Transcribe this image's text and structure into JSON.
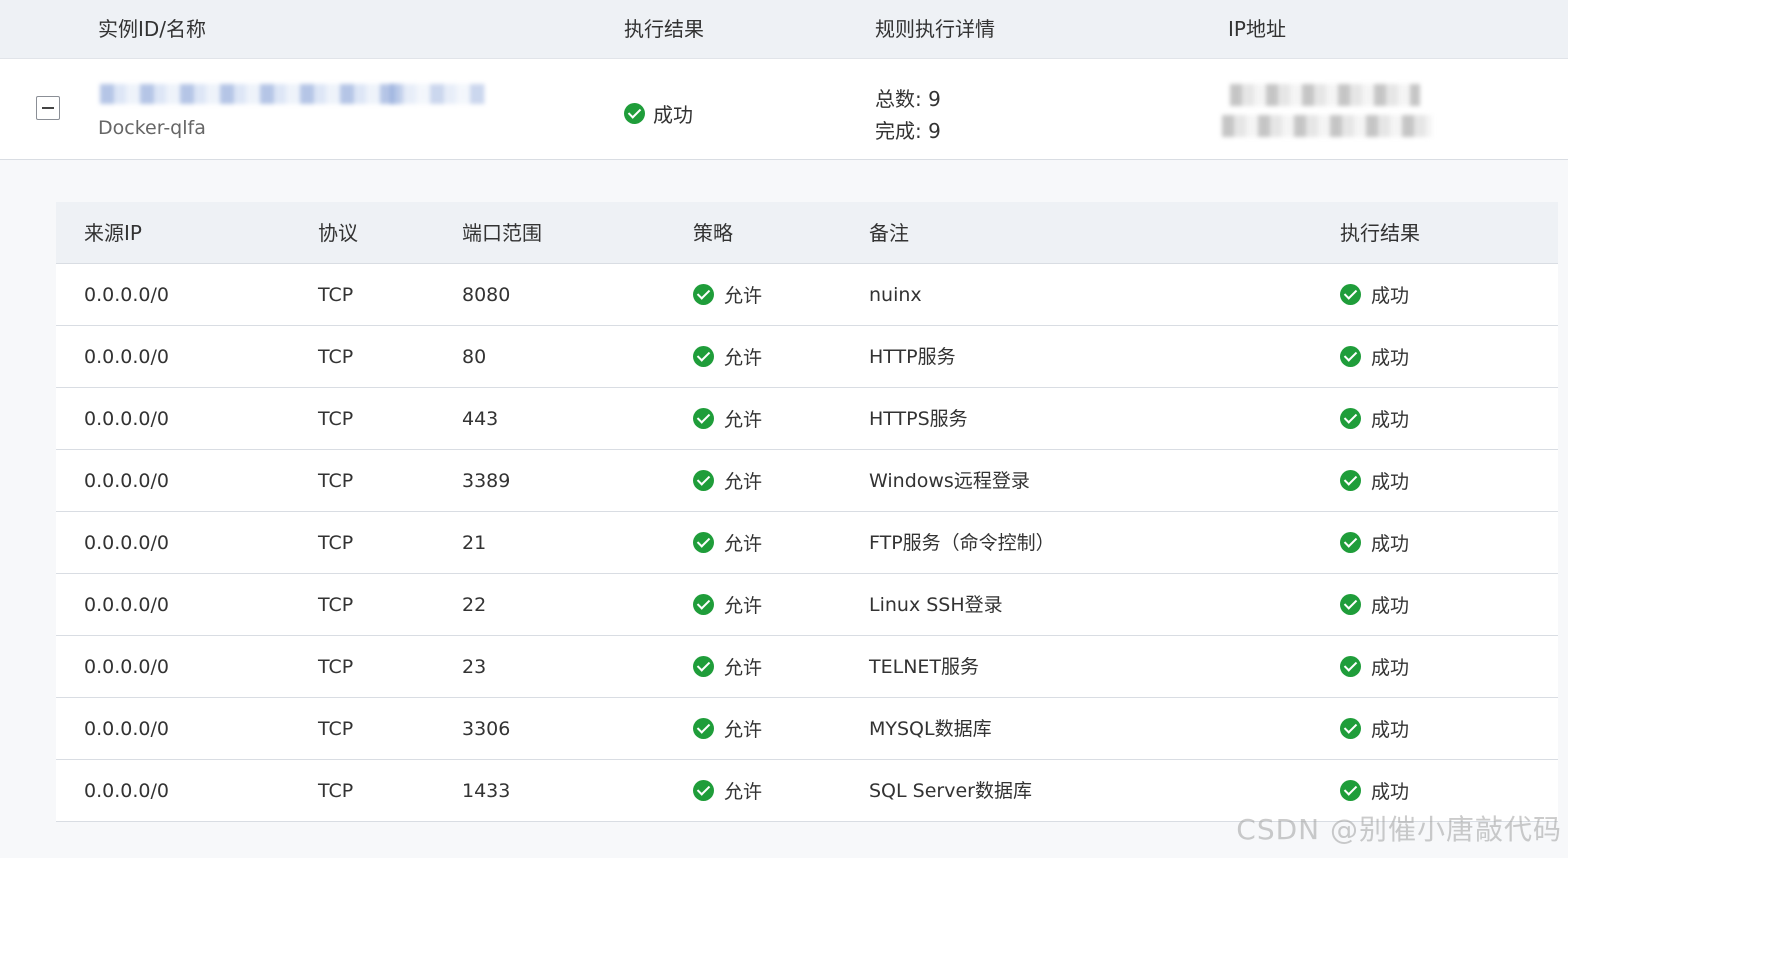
{
  "outer_table": {
    "columns": [
      "实例ID/名称",
      "执行结果",
      "规则执行详情",
      "IP地址"
    ],
    "instance": {
      "name": "Docker-qlfa",
      "result": "成功",
      "detail_total": "总数: 9",
      "detail_done": "完成: 9"
    }
  },
  "inner_table": {
    "columns": [
      "来源IP",
      "协议",
      "端口范围",
      "策略",
      "备注",
      "执行结果"
    ],
    "rows": [
      {
        "source": "0.0.0.0/0",
        "protocol": "TCP",
        "port": "8080",
        "policy": "允许",
        "note": "nuinx",
        "result": "成功"
      },
      {
        "source": "0.0.0.0/0",
        "protocol": "TCP",
        "port": "80",
        "policy": "允许",
        "note": "HTTP服务",
        "result": "成功"
      },
      {
        "source": "0.0.0.0/0",
        "protocol": "TCP",
        "port": "443",
        "policy": "允许",
        "note": "HTTPS服务",
        "result": "成功"
      },
      {
        "source": "0.0.0.0/0",
        "protocol": "TCP",
        "port": "3389",
        "policy": "允许",
        "note": "Windows远程登录",
        "result": "成功"
      },
      {
        "source": "0.0.0.0/0",
        "protocol": "TCP",
        "port": "21",
        "policy": "允许",
        "note": "FTP服务（命令控制）",
        "result": "成功"
      },
      {
        "source": "0.0.0.0/0",
        "protocol": "TCP",
        "port": "22",
        "policy": "允许",
        "note": "Linux SSH登录",
        "result": "成功"
      },
      {
        "source": "0.0.0.0/0",
        "protocol": "TCP",
        "port": "23",
        "policy": "允许",
        "note": "TELNET服务",
        "result": "成功"
      },
      {
        "source": "0.0.0.0/0",
        "protocol": "TCP",
        "port": "3306",
        "policy": "允许",
        "note": "MYSQL数据库",
        "result": "成功"
      },
      {
        "source": "0.0.0.0/0",
        "protocol": "TCP",
        "port": "1433",
        "policy": "允许",
        "note": "SQL Server数据库",
        "result": "成功"
      }
    ]
  },
  "watermark": "CSDN @别催小唐敲代码",
  "colors": {
    "success": "#1f9d3a",
    "header_bg": "#eef1f5",
    "expand_bg": "#f7f8fa"
  }
}
